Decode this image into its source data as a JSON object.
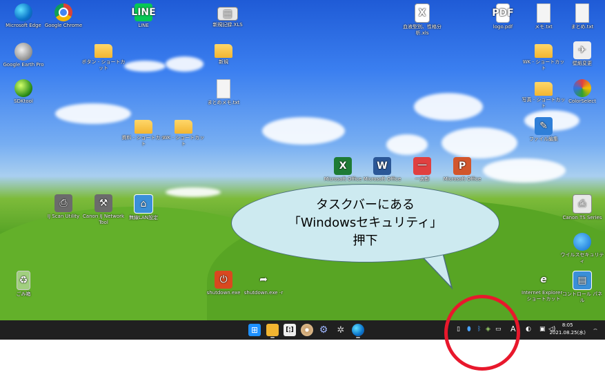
{
  "desktop": {
    "icons_top_row": [
      {
        "label": "Microsoft Edge",
        "icon": "edge-icon"
      },
      {
        "label": "Google Chrome",
        "icon": "chrome-icon"
      },
      {
        "label": "LINE",
        "icon": "line-icon"
      },
      {
        "label": "新規記録.XLS",
        "icon": "spreadsheet-icon"
      },
      {
        "label": "血液型別、性格分析.xls",
        "icon": "excel-file-icon"
      },
      {
        "label": "logo.pdf",
        "icon": "pdf-icon"
      },
      {
        "label": "メモ.txt",
        "icon": "text-file-icon"
      },
      {
        "label": "まとめ.txt",
        "icon": "text-file-icon"
      }
    ],
    "icons_misc": [
      {
        "label": "Google Earth Pro",
        "icon": "earth-icon"
      },
      {
        "label": "ボタン - ショートカット",
        "icon": "folder-icon"
      },
      {
        "label": "新規",
        "icon": "folder-icon"
      },
      {
        "label": "WK - ショートカット",
        "icon": "folder-icon"
      },
      {
        "label": "壁紙変更",
        "icon": "bird-icon"
      },
      {
        "label": "SDKtool",
        "icon": "ball-icon"
      },
      {
        "label": "まとめメモ.txt",
        "icon": "text-file-icon"
      },
      {
        "label": "写真 - ショートカット",
        "icon": "folder-icon"
      },
      {
        "label": "ColorSelect",
        "icon": "colour-icon"
      },
      {
        "label": "資料 - ショートカット",
        "icon": "folder-icon"
      },
      {
        "label": "WK - ショートカット",
        "icon": "folder-icon"
      },
      {
        "label": "ファイル編集",
        "icon": "edit-icon"
      },
      {
        "label": "Microsoft Office",
        "icon": "excel-icon"
      },
      {
        "label": "Microsoft Office",
        "icon": "word-icon"
      },
      {
        "label": "一太郎",
        "icon": "ichitaro-icon"
      },
      {
        "label": "Microsoft Office",
        "icon": "powerpoint-icon"
      },
      {
        "label": "IJ Scan Utility",
        "icon": "scanner-icon"
      },
      {
        "label": "Canon IJ Network Tool",
        "icon": "tool-icon"
      },
      {
        "label": "無線LAN設定",
        "icon": "network-icon"
      },
      {
        "label": "Canon TS Series",
        "icon": "printer-icon"
      },
      {
        "label": "ウイルスセキュリティ",
        "icon": "shield-icon"
      },
      {
        "label": "ごみ箱",
        "icon": "recycle-bin-icon"
      },
      {
        "label": "shutdown.exe",
        "icon": "power-icon"
      },
      {
        "label": "shutdown.exe -r",
        "icon": "restart-icon"
      },
      {
        "label": "Internet Explorer - ショートカット",
        "icon": "ie-icon"
      },
      {
        "label": "コントロール パネル",
        "icon": "control-panel-icon"
      }
    ]
  },
  "callout": {
    "line1": "タスクバーにある",
    "line2": "「Windowsセキュリティ」",
    "line3": "押下"
  },
  "taskbar": {
    "apps": [
      "start-icon",
      "file-explorer-icon",
      "notepad-icon",
      "cd-icon",
      "settings-icon",
      "gear-icon",
      "edge-icon"
    ],
    "tray": {
      "input_indicator": "A",
      "time": "8:05",
      "date": "2021.08.25(水)"
    }
  },
  "colors": {
    "taskbar": "#202020",
    "callout_fill": "#cdeaf0",
    "highlight_circle": "#e8182c"
  }
}
